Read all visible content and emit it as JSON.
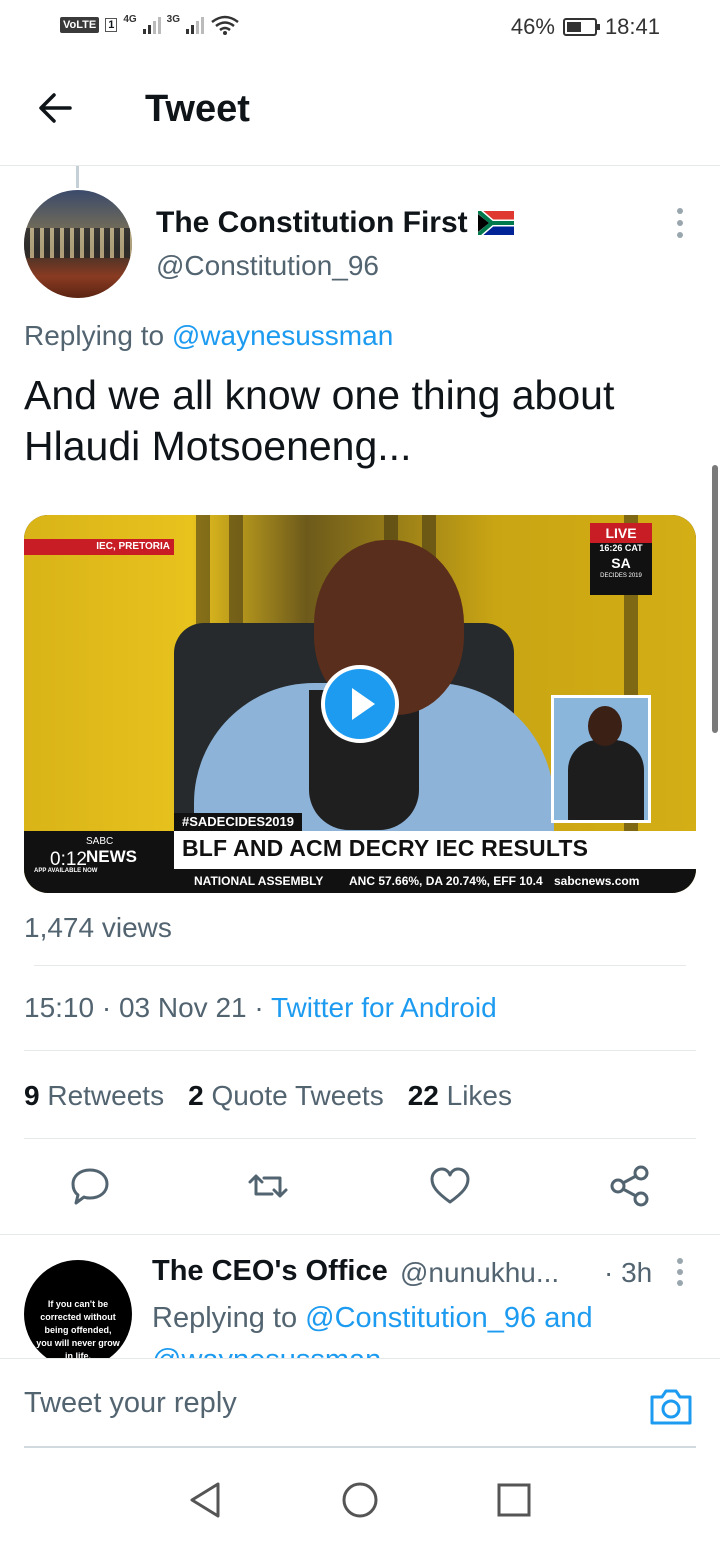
{
  "status_bar": {
    "volte": "VoLTE",
    "sim": "1",
    "net1": "4G",
    "net2": "3G",
    "battery": "46%",
    "time": "18:41"
  },
  "header": {
    "title": "Tweet"
  },
  "tweet": {
    "author_name": "The Constitution First",
    "author_handle": "@Constitution_96",
    "replying_prefix": "Replying to",
    "replying_to": "@waynesussman",
    "text": "And we all know one thing about Hlaudi Motsoeneng...",
    "video": {
      "station": "IEC, PRETORIA",
      "live": "LIVE",
      "live_time": "16:26 CAT",
      "badge": "SA",
      "badge_sub": "DECIDES 2019",
      "hashtag": "#SADECIDES2019",
      "logo_top": "SABC",
      "logo_main": "NEWS",
      "logo_app": "APP AVAILABLE NOW",
      "headline": "BLF AND ACM DECRY IEC RESULTS",
      "ticker_left": "NATIONAL ASSEMBLY",
      "ticker_results": "ANC 57.66%, DA 20.74%, EFF 10.4",
      "ticker_site": "sabcnews.com",
      "duration": "0:12"
    },
    "views": "1,474 views",
    "time": "15:10",
    "date": "03 Nov 21",
    "source": "Twitter for Android",
    "retweets_count": "9",
    "retweets_label": "Retweets",
    "quotes_count": "2",
    "quotes_label": "Quote Tweets",
    "likes_count": "22",
    "likes_label": "Likes"
  },
  "reply": {
    "avatar_text": "If you can't be corrected without being offended, you will never grow in life.",
    "name": "The CEO's Office",
    "handle": "@nunukhu...",
    "time": "· 3h",
    "replying_prefix": "Replying to",
    "replying_to_1": "@Constitution_96",
    "and": "and",
    "replying_to_2": "@waynesussman"
  },
  "compose": {
    "placeholder": "Tweet your reply"
  },
  "colors": {
    "accent": "#1d9bf0",
    "secondary_text": "#536471",
    "primary_text": "#0f1419"
  }
}
